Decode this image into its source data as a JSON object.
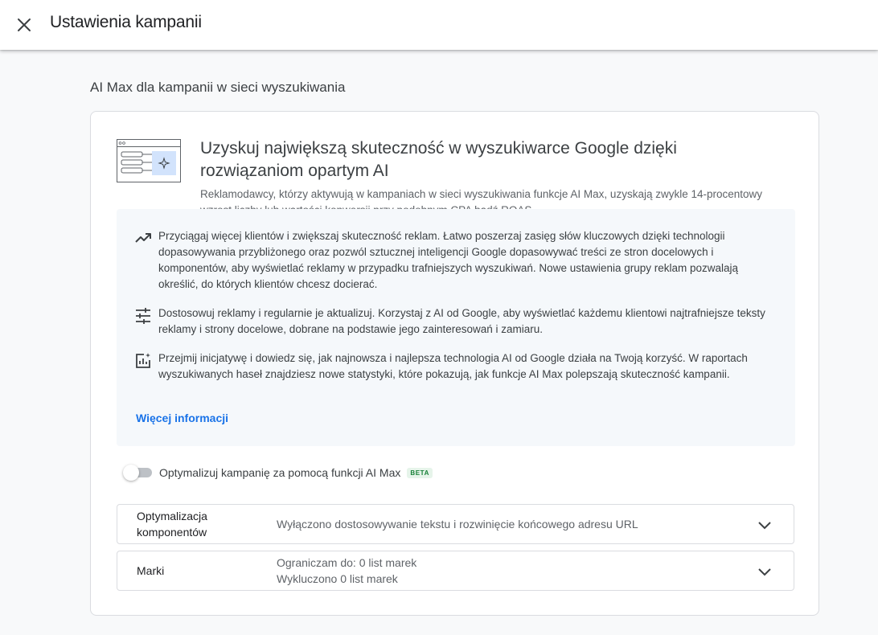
{
  "header": {
    "title": "Ustawienia kampanii",
    "close_icon": "close-icon"
  },
  "section": {
    "title": "AI Max dla kampanii w sieci wyszukiwania"
  },
  "promo": {
    "title": "Uzyskuj największą skuteczność w wyszukiwarce Google dzięki rozwiązaniom opartym AI",
    "subtitle": "Reklamodawcy, którzy aktywują w kampaniach w sieci wyszukiwania funkcje AI Max, uzyskają zwykle 14-procentowy wzrost liczby lub wartości konwersji przy podobnym CPA bądź ROAS",
    "illustration_icon": "search-ai-illustration-icon"
  },
  "benefits": [
    {
      "icon": "trending-up-icon",
      "text": "Przyciągaj więcej klientów i zwiększaj skuteczność reklam. Łatwo poszerzaj zasięg słów kluczowych dzięki technologii dopasowywania przybliżonego oraz pozwól sztucznej inteligencji Google dopasowywać treści ze stron docelowych i komponentów, aby wyświetlać reklamy w przypadku trafniejszych wyszukiwań. Nowe ustawienia grupy reklam pozwalają określić, do których klientów chcesz docierać."
    },
    {
      "icon": "tune-icon",
      "text": "Dostosowuj reklamy i regularnie je aktualizuj. Korzystaj z AI od Google, aby wyświetlać każdemu klientowi najtrafniejsze teksty reklamy i strony docelowe, dobrane na podstawie jego zainteresowań i zamiaru."
    },
    {
      "icon": "insights-icon",
      "text": "Przejmij inicjatywę i dowiedz się, jak najnowsza i najlepsza technologia AI od Google działa na Twoją korzyść. W raportach wyszukiwanych haseł znajdziesz nowe statystyki, które pokazują, jak funkcje AI Max polepszają skuteczność kampanii."
    }
  ],
  "learn_more": "Więcej informacji",
  "toggle": {
    "label": "Optymalizuj kampanię za pomocą funkcji AI Max",
    "badge": "BETA",
    "enabled": false
  },
  "rows": [
    {
      "label": "Optymalizacja komponentów",
      "value_lines": [
        "Wyłączono dostosowywanie tekstu i rozwinięcie końcowego adresu URL"
      ]
    },
    {
      "label": "Marki",
      "value_lines": [
        "Ograniczam do: 0 list marek",
        "Wykluczono 0 list marek"
      ]
    }
  ],
  "colors": {
    "accent": "#1a73e8",
    "beta_text": "#188038",
    "beta_bg": "#e6f4ea",
    "benefits_bg": "#f5f8fb"
  }
}
